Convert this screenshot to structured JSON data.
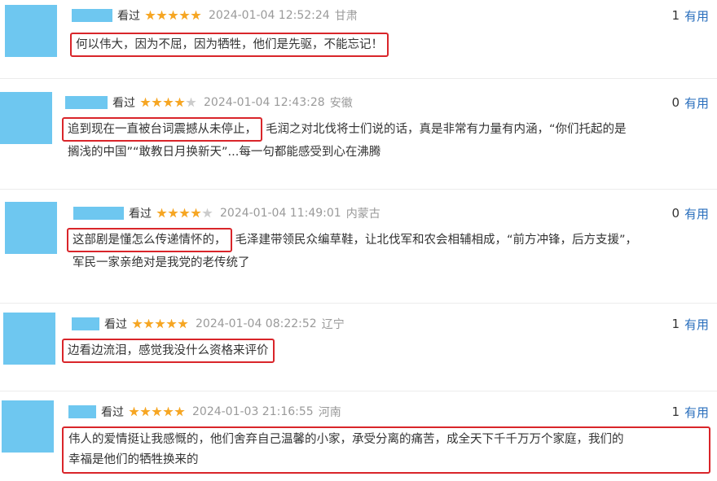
{
  "reviews": [
    {
      "watched": "看过",
      "stars": 5,
      "datetime": "2024-01-04 12:52:24",
      "location": "甘肃",
      "useful_count": "1",
      "useful_label": "有用",
      "highlight": "何以伟大，因为不屈，因为牺牲，他们是先驱，不能忘记！",
      "rest": "",
      "continuation": ""
    },
    {
      "watched": "看过",
      "stars": 4,
      "datetime": "2024-01-04 12:43:28",
      "location": "安徽",
      "useful_count": "0",
      "useful_label": "有用",
      "highlight": "追到现在一直被台词震撼从未停止，",
      "rest": "毛润之对北伐将士们说的话，真是非常有力量有内涵，“你们托起的是",
      "continuation": "搁浅的中国”“敢教日月换新天”...每一句都能感受到心在沸腾"
    },
    {
      "watched": "看过",
      "stars": 4,
      "datetime": "2024-01-04 11:49:01",
      "location": "内蒙古",
      "useful_count": "0",
      "useful_label": "有用",
      "highlight": "这部剧是懂怎么传递情怀的，",
      "rest": "毛泽建带领民众编草鞋，让北伐军和农会相辅相成，“前方冲锋，后方支援”，",
      "continuation": "军民一家亲绝对是我党的老传统了"
    },
    {
      "watched": "看过",
      "stars": 5,
      "datetime": "2024-01-04 08:22:52",
      "location": "辽宁",
      "useful_count": "1",
      "useful_label": "有用",
      "highlight": "边看边流泪，感觉我没什么资格来评价",
      "rest": "",
      "continuation": ""
    },
    {
      "watched": "看过",
      "stars": 5,
      "datetime": "2024-01-03 21:16:55",
      "location": "河南",
      "useful_count": "1",
      "useful_label": "有用",
      "highlight": "伟人的爱情挺让我感慨的，他们舍弃自己温馨的小家，承受分离的痛苦，成全天下千千万万个家庭，我们的",
      "rest": "",
      "continuation": "幸福是他们的牺牲换来的"
    }
  ]
}
